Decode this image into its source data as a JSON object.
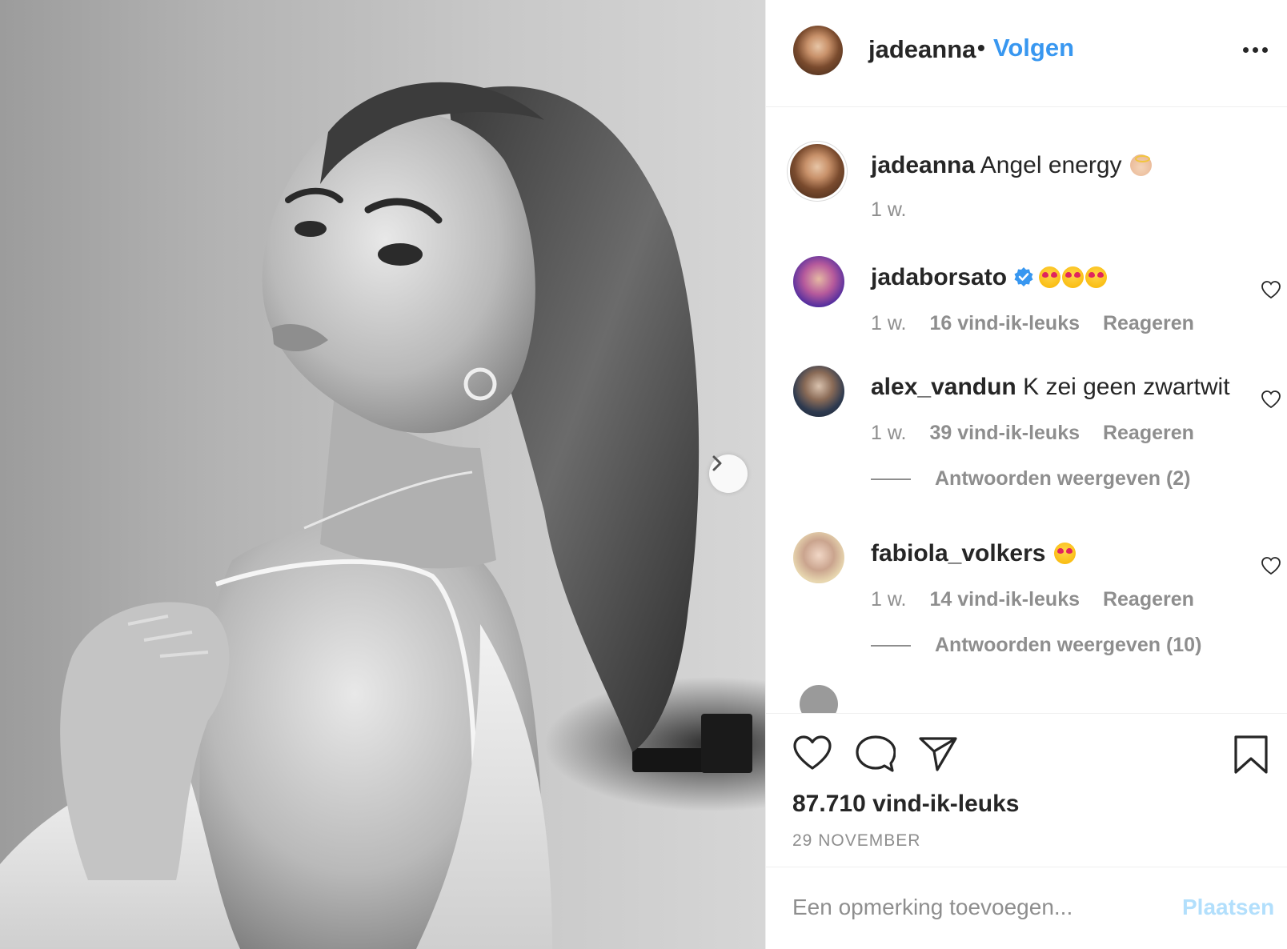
{
  "post": {
    "image_alt_icon": "photo",
    "next_icon": "chevron-right-icon"
  },
  "header": {
    "username": "jadeanna",
    "separator": "•",
    "follow_label": "Volgen",
    "more_icon": "more-horizontal-icon"
  },
  "caption": {
    "username": "jadeanna",
    "text": "Angel energy",
    "emoji": "angel-emoji",
    "time": "1 w."
  },
  "comments": [
    {
      "username": "jadaborsato",
      "verified": true,
      "text": "",
      "emoji": [
        "heart-eyes-emoji",
        "heart-eyes-emoji",
        "heart-eyes-emoji"
      ],
      "time": "1 w.",
      "likes": "16 vind-ik-leuks",
      "reply": "Reageren"
    },
    {
      "username": "alex_vandun",
      "verified": false,
      "text": "K zei geen zwartwit",
      "time": "1 w.",
      "likes": "39 vind-ik-leuks",
      "reply": "Reageren",
      "view_replies": "Antwoorden weergeven (2)"
    },
    {
      "username": "fabiola_volkers",
      "verified": false,
      "text": "",
      "emoji": [
        "heart-eyes-emoji"
      ],
      "time": "1 w.",
      "likes": "14 vind-ik-leuks",
      "reply": "Reageren",
      "view_replies": "Antwoorden weergeven (10)"
    }
  ],
  "actions": {
    "like_icon": "heart-icon",
    "comment_icon": "comment-icon",
    "share_icon": "paper-plane-icon",
    "save_icon": "bookmark-icon"
  },
  "likes_count": "87.710 vind-ik-leuks",
  "date": "29 NOVEMBER",
  "composer": {
    "placeholder": "Een opmerking toevoegen...",
    "post_label": "Plaatsen"
  },
  "colors": {
    "link_blue": "#3897f0",
    "post_disabled": "#b2dffc",
    "muted": "#8e8e8e",
    "text": "#262626",
    "verified_blue": "#3897f0"
  }
}
